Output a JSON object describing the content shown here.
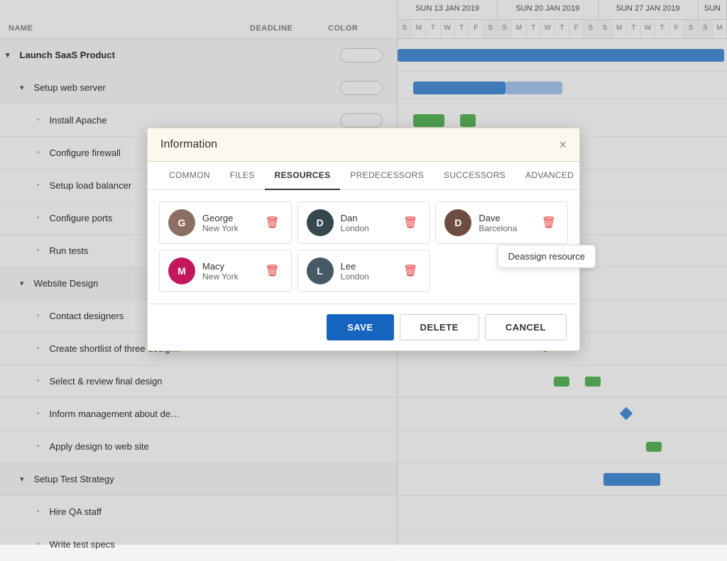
{
  "header": {
    "col_name": "NAME",
    "col_deadline": "DEADLINE",
    "col_color": "COLOR"
  },
  "tasks": [
    {
      "id": "t1",
      "label": "Launch SaaS Product",
      "indent": 0,
      "type": "group",
      "has_toggle": true
    },
    {
      "id": "t2",
      "label": "Setup web server",
      "indent": 1,
      "type": "subgroup",
      "has_toggle": true
    },
    {
      "id": "t3",
      "label": "Install Apache",
      "indent": 2,
      "type": "task"
    },
    {
      "id": "t4",
      "label": "Configure firewall",
      "indent": 2,
      "type": "task"
    },
    {
      "id": "t5",
      "label": "Setup load balancer",
      "indent": 2,
      "type": "task"
    },
    {
      "id": "t6",
      "label": "Configure ports",
      "indent": 2,
      "type": "task"
    },
    {
      "id": "t7",
      "label": "Run tests",
      "indent": 2,
      "type": "task"
    },
    {
      "id": "t8",
      "label": "Website Design",
      "indent": 1,
      "type": "subgroup",
      "has_toggle": true
    },
    {
      "id": "t9",
      "label": "Contact designers",
      "indent": 2,
      "type": "task"
    },
    {
      "id": "t10",
      "label": "Create shortlist of three desig…",
      "indent": 2,
      "type": "task"
    },
    {
      "id": "t11",
      "label": "Select & review final design",
      "indent": 2,
      "type": "task"
    },
    {
      "id": "t12",
      "label": "Inform management about de…",
      "indent": 2,
      "type": "task"
    },
    {
      "id": "t13",
      "label": "Apply design to web site",
      "indent": 2,
      "type": "task"
    },
    {
      "id": "t14",
      "label": "Setup Test Strategy",
      "indent": 1,
      "type": "subgroup",
      "has_toggle": true
    },
    {
      "id": "t15",
      "label": "Hire QA staff",
      "indent": 2,
      "type": "task"
    },
    {
      "id": "t16",
      "label": "Write test specs",
      "indent": 2,
      "type": "task"
    }
  ],
  "modal": {
    "title": "Information",
    "close_label": "×",
    "tabs": [
      {
        "id": "common",
        "label": "COMMON",
        "active": false
      },
      {
        "id": "files",
        "label": "FILES",
        "active": false
      },
      {
        "id": "resources",
        "label": "RESOURCES",
        "active": true
      },
      {
        "id": "predecessors",
        "label": "PREDECESSORS",
        "active": false
      },
      {
        "id": "successors",
        "label": "SUCCESSORS",
        "active": false
      },
      {
        "id": "advanced",
        "label": "ADVANCED",
        "active": false
      }
    ],
    "resources": [
      {
        "id": "george",
        "name": "George",
        "location": "New York",
        "avatar_initials": "G",
        "avatar_class": "av-george"
      },
      {
        "id": "dan",
        "name": "Dan",
        "location": "London",
        "avatar_initials": "D",
        "avatar_class": "av-dan"
      },
      {
        "id": "dave",
        "name": "Dave",
        "location": "Barcelona",
        "avatar_initials": "D",
        "avatar_class": "av-dave",
        "show_tooltip": true
      },
      {
        "id": "macy",
        "name": "Macy",
        "location": "New York",
        "avatar_initials": "M",
        "avatar_class": "av-macy"
      },
      {
        "id": "lee",
        "name": "Lee",
        "location": "London",
        "avatar_initials": "L",
        "avatar_class": "av-lee"
      }
    ],
    "tooltip": "Deassign resource",
    "buttons": {
      "save": "SAVE",
      "delete": "DELETE",
      "cancel": "CANCEL"
    }
  },
  "gantt": {
    "weeks": [
      {
        "label": "SUN 13 JAN 2019",
        "days": [
          "S",
          "M",
          "T",
          "W",
          "T",
          "F",
          "S"
        ]
      },
      {
        "label": "SUN 20 JAN 2019",
        "days": [
          "S",
          "M",
          "T",
          "W",
          "T",
          "F",
          "S"
        ]
      },
      {
        "label": "SUN 27 JAN 2019",
        "days": [
          "S",
          "M",
          "T",
          "W",
          "T",
          "F",
          "S"
        ]
      },
      {
        "label": "SUN",
        "days": [
          "S",
          "M"
        ]
      }
    ]
  }
}
